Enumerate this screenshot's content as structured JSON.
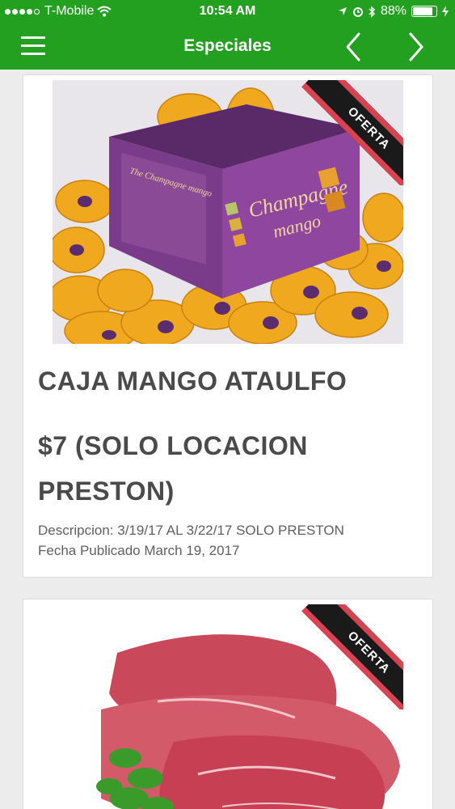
{
  "status_bar": {
    "carrier": "T-Mobile",
    "time": "10:54 AM",
    "battery_percent": "88%",
    "battery_level": 0.88,
    "icons": [
      "signal-icon",
      "wifi-icon",
      "location-icon",
      "alarm-icon",
      "bluetooth-icon",
      "battery-icon",
      "charging-icon"
    ]
  },
  "header": {
    "title": "Especiales",
    "menu_icon": "hamburger-menu-icon",
    "prev_icon": "chevron-left-icon",
    "next_icon": "chevron-right-icon"
  },
  "colors": {
    "brand_green": "#24a020",
    "ribbon_black": "#1a1a1a",
    "ribbon_red": "#d9434f",
    "title_text": "#4a4a4a"
  },
  "specials": [
    {
      "badge": "OFERTA",
      "title": "CAJA MANGO ATAULFO",
      "price": "$7 (SOLO LOCACION PRESTON)",
      "description": "Descripcion: 3/19/17 AL 3/22/17 SOLO PRESTON",
      "published": "Fecha Publicado March 19, 2017",
      "image": {
        "box_text_1": "Champagne",
        "box_text_2": "mango",
        "box_side_text": "The Champagne mango"
      }
    },
    {
      "badge": "OFERTA"
    }
  ]
}
